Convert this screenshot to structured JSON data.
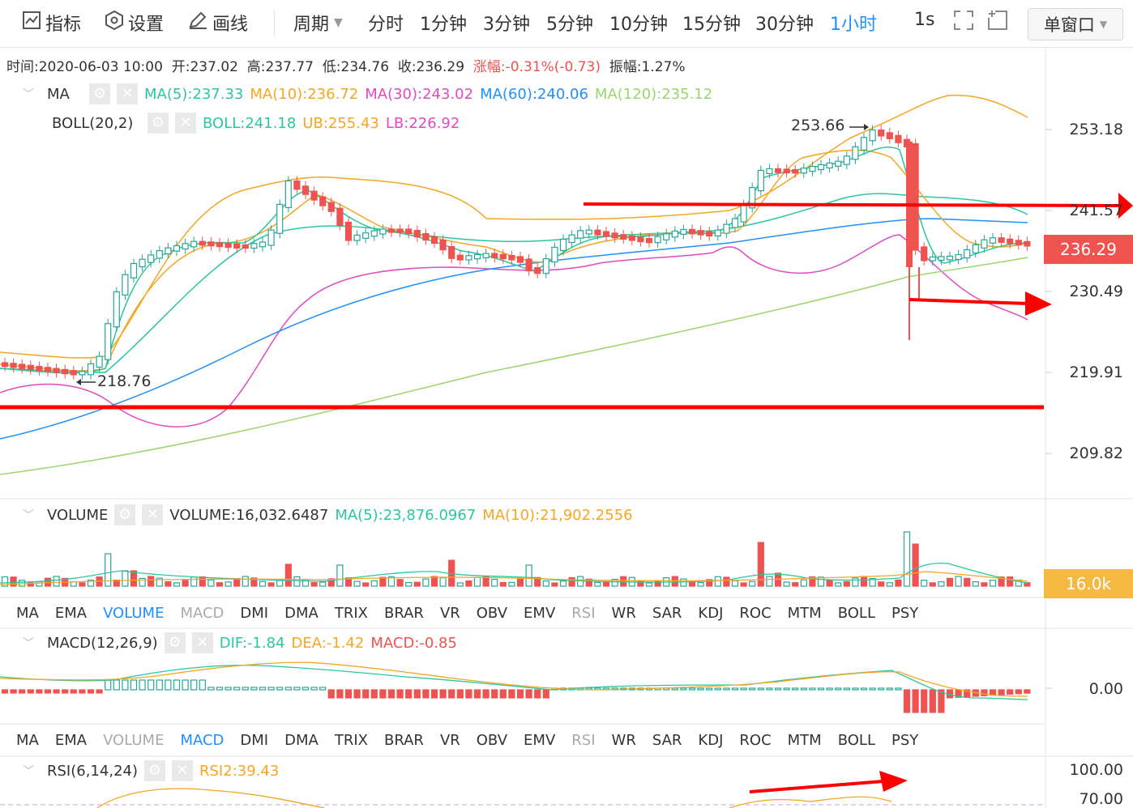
{
  "toolbar": {
    "indicator_label": "指标",
    "settings_label": "设置",
    "draw_label": "画线",
    "period_label": "周期",
    "periods": [
      "分时",
      "1分钟",
      "3分钟",
      "5分钟",
      "10分钟",
      "15分钟",
      "30分钟",
      "1小时"
    ],
    "active_period": "1小时",
    "refresh_label": "1s",
    "window_mode": "单窗口"
  },
  "info": {
    "time": "时间:2020-06-03 10:00",
    "open": "开:237.02",
    "high": "高:237.77",
    "low": "低:234.76",
    "close": "收:236.29",
    "change": "涨幅:-0.31%(-0.73)",
    "amplitude": "振幅:1.27%"
  },
  "main_chart": {
    "ma_name": "MA",
    "ma_values": {
      "ma5": "MA(5):237.33",
      "ma10": "MA(10):236.72",
      "ma30": "MA(30):243.02",
      "ma60": "MA(60):240.06",
      "ma120": "MA(120):235.12"
    },
    "boll_name": "BOLL(20,2)",
    "boll_values": {
      "boll": "BOLL:241.18",
      "ub": "UB:255.43",
      "lb": "LB:226.92"
    },
    "high_annotation": "253.66",
    "low_annotation": "218.76",
    "y_axis_ticks": [
      "253.18",
      "241.57",
      "230.49",
      "219.91",
      "209.82"
    ],
    "current_price": "236.29"
  },
  "volume_panel": {
    "name": "VOLUME",
    "value": "VOLUME:16,032.6487",
    "ma5": "MA(5):23,876.0967",
    "ma10": "MA(10):21,902.2556",
    "current_volume": "16.0k"
  },
  "indicator_tabs": [
    "MA",
    "EMA",
    "VOLUME",
    "MACD",
    "DMI",
    "DMA",
    "TRIX",
    "BRAR",
    "VR",
    "OBV",
    "EMV",
    "RSI",
    "WR",
    "SAR",
    "KDJ",
    "ROC",
    "MTM",
    "BOLL",
    "PSY"
  ],
  "macd_panel": {
    "name": "MACD(12,26,9)",
    "dif": "DIF:-1.84",
    "dea": "DEA:-1.42",
    "macd": "MACD:-0.85",
    "zero_tick": "0.00"
  },
  "rsi_panel": {
    "name": "RSI(6,14,24)",
    "rsi2": "RSI2:39.43",
    "ticks": [
      "100.00",
      "70.00"
    ]
  },
  "colors": {
    "up": "#26a69a",
    "down": "#ef5350",
    "ma5": "#2bc6a0",
    "ma10": "#f5a623",
    "ma30": "#e24ac2",
    "ma60": "#1e90ff",
    "ma120": "#9ad66b",
    "accent": "#1e90ff",
    "price_tag": "#ef5350",
    "volume_tag": "#f5b942",
    "annotation": "#ff0000"
  }
}
